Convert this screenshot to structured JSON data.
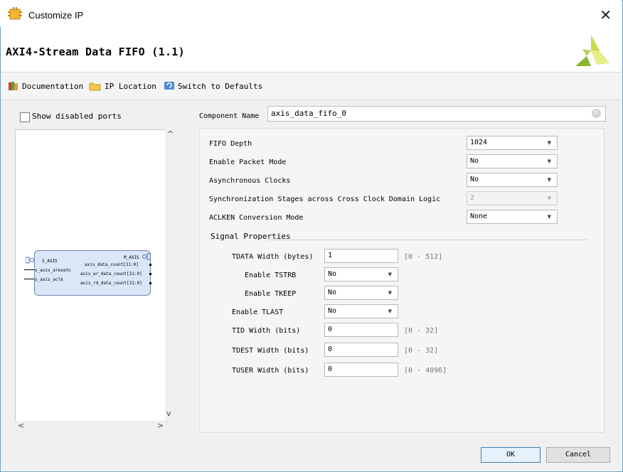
{
  "window": {
    "title": "Customize IP",
    "close_glyph": "✕"
  },
  "header": {
    "title": "AXI4-Stream Data FIFO (1.1)",
    "logo_icon": "xilinx-logo-icon"
  },
  "toolbar": {
    "documentation": "Documentation",
    "ip_location": "IP Location",
    "switch_defaults": "Switch to Defaults"
  },
  "left_panel": {
    "show_disabled_ports": "Show disabled ports",
    "show_disabled_checked": false,
    "block": {
      "s_axis": "S_AXIS",
      "m_axis": "M_AXIS",
      "port_aresetn": "s_axis_aresetn",
      "port_aclk": "s_axis_aclk",
      "out_data_count": "axis_data_count[31:0]",
      "out_wr_count": "axis_wr_data_count[31:0]",
      "out_rd_count": "axis_rd_data_count[31:0]"
    }
  },
  "component": {
    "label": "Component Name",
    "value": "axis_data_fifo_0"
  },
  "form": {
    "fifo_depth": {
      "label": "FIFO Depth",
      "value": "1024"
    },
    "packet_mode": {
      "label": "Enable Packet Mode",
      "value": "No"
    },
    "async_clocks": {
      "label": "Asynchronous Clocks",
      "value": "No"
    },
    "sync_stages": {
      "label": "Synchronization Stages across Cross Clock Domain Logic",
      "value": "2"
    },
    "aclken": {
      "label": "ACLKEN Conversion Mode",
      "value": "None"
    },
    "signal_props": "Signal Properties",
    "tdata": {
      "label": "TDATA Width (bytes)",
      "value": "1",
      "range": "[0 - 512]"
    },
    "tstrb": {
      "label": "Enable TSTRB",
      "value": "No"
    },
    "tkeep": {
      "label": "Enable TKEEP",
      "value": "No"
    },
    "tlast": {
      "label": "Enable TLAST",
      "value": "No"
    },
    "tid": {
      "label": "TID Width (bits)",
      "value": "0",
      "range": "[0 - 32]"
    },
    "tdest": {
      "label": "TDEST Width (bits)",
      "value": "0",
      "range": "[0 - 32]"
    },
    "tuser": {
      "label": "TUSER Width (bits)",
      "value": "0",
      "range": "[0 - 4096]"
    }
  },
  "footer": {
    "ok": "OK",
    "cancel": "Cancel"
  }
}
